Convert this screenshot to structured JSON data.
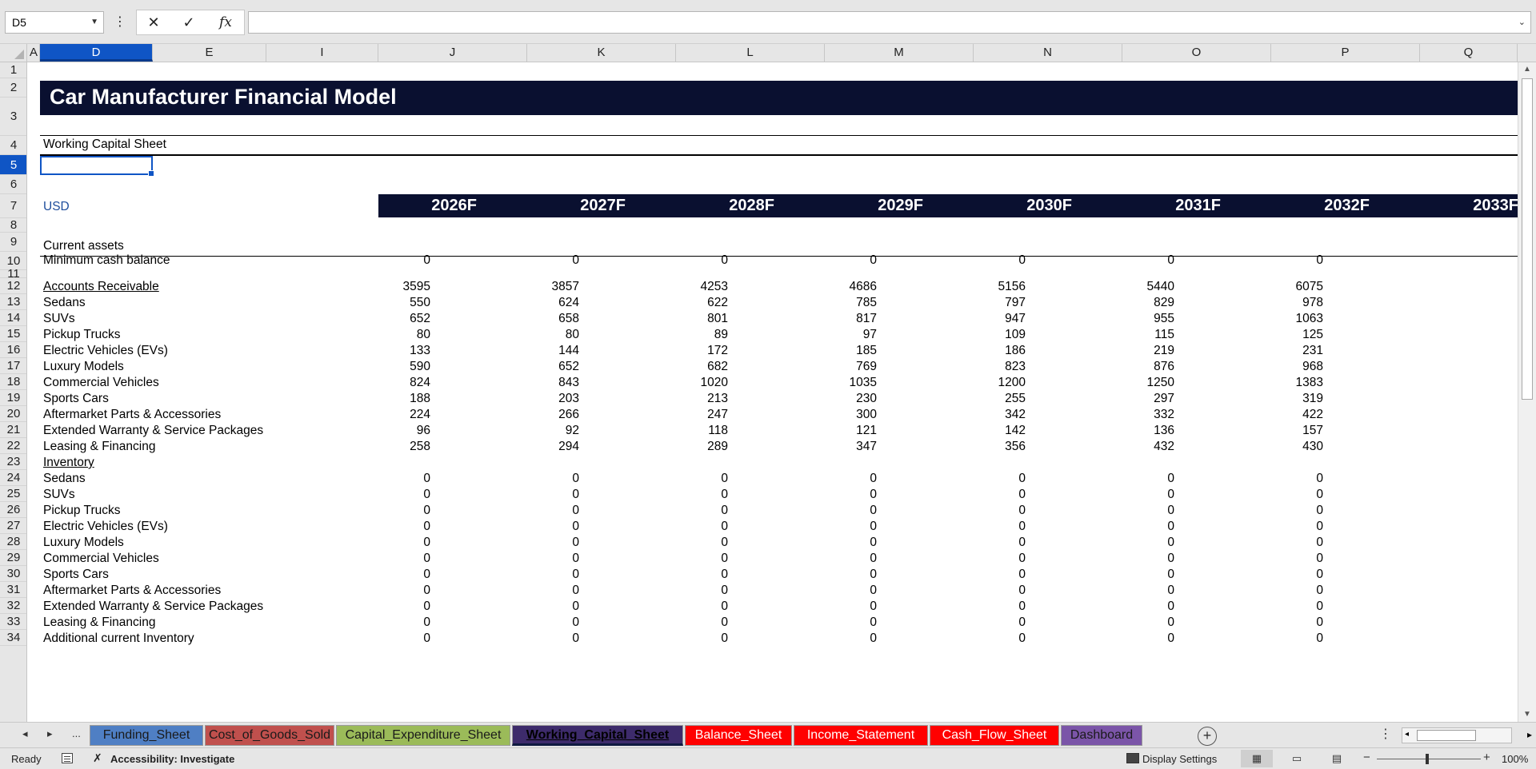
{
  "formula_bar": {
    "name_box": "D5",
    "formula": ""
  },
  "columns": [
    "A",
    "D",
    "E",
    "I",
    "J",
    "K",
    "L",
    "M",
    "N",
    "O",
    "P",
    "Q"
  ],
  "rows": [
    "1",
    "2",
    "3",
    "4",
    "5",
    "6",
    "7",
    "8",
    "9",
    "10",
    "11",
    "12",
    "13",
    "14",
    "15",
    "16",
    "17",
    "18",
    "19",
    "20",
    "21",
    "22",
    "23",
    "24",
    "25",
    "26",
    "27",
    "28",
    "29",
    "30",
    "31",
    "32",
    "33",
    "34"
  ],
  "sheet": {
    "title": "Car Manufacturer Financial Model",
    "subtitle": "Working Capital Sheet",
    "currency_label": "USD",
    "years": [
      "2026F",
      "2027F",
      "2028F",
      "2029F",
      "2030F",
      "2031F",
      "2032F",
      "2033F"
    ],
    "section_current_assets": "Current assets",
    "min_cash": {
      "label": "Minimum cash balance",
      "values": [
        "0",
        "0",
        "0",
        "0",
        "0",
        "0",
        "0"
      ]
    },
    "ar": {
      "label": "Accounts Receivable",
      "values": [
        "3595",
        "3857",
        "4253",
        "4686",
        "5156",
        "5440",
        "6075"
      ]
    },
    "ar_items": [
      {
        "label": "Sedans",
        "values": [
          "550",
          "624",
          "622",
          "785",
          "797",
          "829",
          "978"
        ]
      },
      {
        "label": "SUVs",
        "values": [
          "652",
          "658",
          "801",
          "817",
          "947",
          "955",
          "1063"
        ]
      },
      {
        "label": "Pickup Trucks",
        "values": [
          "80",
          "80",
          "89",
          "97",
          "109",
          "115",
          "125"
        ]
      },
      {
        "label": "Electric Vehicles (EVs)",
        "values": [
          "133",
          "144",
          "172",
          "185",
          "186",
          "219",
          "231"
        ]
      },
      {
        "label": "Luxury Models",
        "values": [
          "590",
          "652",
          "682",
          "769",
          "823",
          "876",
          "968"
        ]
      },
      {
        "label": "Commercial Vehicles",
        "values": [
          "824",
          "843",
          "1020",
          "1035",
          "1200",
          "1250",
          "1383"
        ]
      },
      {
        "label": "Sports Cars",
        "values": [
          "188",
          "203",
          "213",
          "230",
          "255",
          "297",
          "319"
        ]
      },
      {
        "label": "Aftermarket Parts & Accessories",
        "values": [
          "224",
          "266",
          "247",
          "300",
          "342",
          "332",
          "422"
        ]
      },
      {
        "label": "Extended Warranty & Service Packages",
        "values": [
          "96",
          "92",
          "118",
          "121",
          "142",
          "136",
          "157"
        ]
      },
      {
        "label": "Leasing & Financing",
        "values": [
          "258",
          "294",
          "289",
          "347",
          "356",
          "432",
          "430"
        ]
      }
    ],
    "inventory": {
      "label": "Inventory"
    },
    "inv_items": [
      {
        "label": "Sedans",
        "values": [
          "0",
          "0",
          "0",
          "0",
          "0",
          "0",
          "0"
        ]
      },
      {
        "label": "SUVs",
        "values": [
          "0",
          "0",
          "0",
          "0",
          "0",
          "0",
          "0"
        ]
      },
      {
        "label": "Pickup Trucks",
        "values": [
          "0",
          "0",
          "0",
          "0",
          "0",
          "0",
          "0"
        ]
      },
      {
        "label": "Electric Vehicles (EVs)",
        "values": [
          "0",
          "0",
          "0",
          "0",
          "0",
          "0",
          "0"
        ]
      },
      {
        "label": "Luxury Models",
        "values": [
          "0",
          "0",
          "0",
          "0",
          "0",
          "0",
          "0"
        ]
      },
      {
        "label": "Commercial Vehicles",
        "values": [
          "0",
          "0",
          "0",
          "0",
          "0",
          "0",
          "0"
        ]
      },
      {
        "label": "Sports Cars",
        "values": [
          "0",
          "0",
          "0",
          "0",
          "0",
          "0",
          "0"
        ]
      },
      {
        "label": "Aftermarket Parts & Accessories",
        "values": [
          "0",
          "0",
          "0",
          "0",
          "0",
          "0",
          "0"
        ]
      },
      {
        "label": "Extended Warranty & Service Packages",
        "values": [
          "0",
          "0",
          "0",
          "0",
          "0",
          "0",
          "0"
        ]
      },
      {
        "label": "Leasing & Financing",
        "values": [
          "0",
          "0",
          "0",
          "0",
          "0",
          "0",
          "0"
        ]
      },
      {
        "label": "Additional current Inventory",
        "values": [
          "0",
          "0",
          "0",
          "0",
          "0",
          "0",
          "0"
        ]
      }
    ]
  },
  "tabs": [
    {
      "label": "Funding_Sheet",
      "color": "#4f7fc4",
      "text": "#1a1a1a"
    },
    {
      "label": "Cost_of_Goods_Sold",
      "color": "#c0504d",
      "text": "#1a1a1a"
    },
    {
      "label": "Capital_Expenditure_Sheet",
      "color": "#9bbb59",
      "text": "#1a1a1a"
    },
    {
      "label": "Working_Capital_Sheet",
      "color": "#3d2b6b",
      "text": "#000000"
    },
    {
      "label": "Balance_Sheet",
      "color": "#ff0000",
      "text": "#ffffff"
    },
    {
      "label": "Income_Statement",
      "color": "#ff0000",
      "text": "#ffffff"
    },
    {
      "label": "Cash_Flow_Sheet",
      "color": "#ff0000",
      "text": "#ffffff"
    },
    {
      "label": "Dashboard",
      "color": "#7b55a8",
      "text": "#1a1a1a"
    }
  ],
  "tabs_nav": {
    "prev": "◂",
    "next": "▸",
    "more": "..."
  },
  "status": {
    "ready": "Ready",
    "accessibility": "Accessibility: Investigate",
    "display_settings": "Display Settings",
    "zoom": "100%"
  },
  "colors": {
    "header_band": "#0a1030",
    "selection": "#0f55c5",
    "usd_text": "#1f4e9c"
  }
}
